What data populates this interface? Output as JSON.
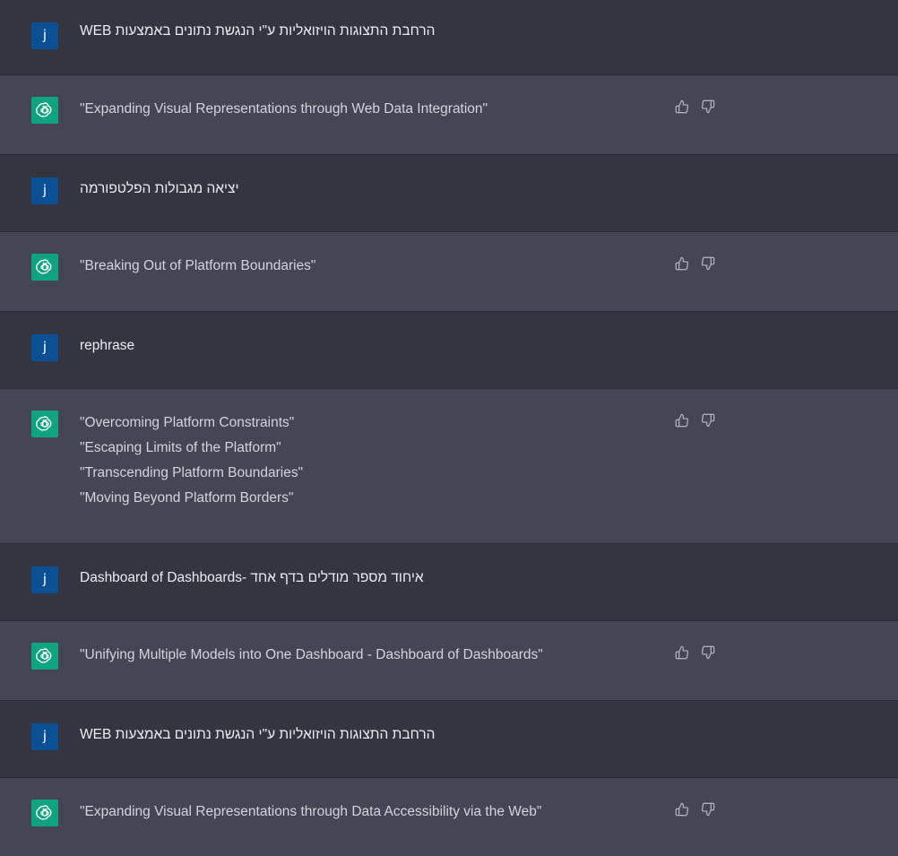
{
  "colors": {
    "user_bg": "#343541",
    "bot_bg": "#444654",
    "user_avatar": "#0b4f94",
    "bot_avatar": "#10a37f",
    "text": "#ececf1"
  },
  "user_avatar_letter": "j",
  "messages": [
    {
      "role": "user",
      "text": "הרחבת התצוגות הויזואליות ע\"י הנגשת נתונים באמצעות WEB"
    },
    {
      "role": "assistant",
      "lines": [
        "\"Expanding Visual Representations through Web Data Integration\""
      ]
    },
    {
      "role": "user",
      "text": "יציאה מגבולות הפלטפורמה"
    },
    {
      "role": "assistant",
      "lines": [
        "\"Breaking Out of Platform Boundaries\""
      ]
    },
    {
      "role": "user",
      "text": "rephrase"
    },
    {
      "role": "assistant",
      "lines": [
        "\"Overcoming Platform Constraints\"",
        "\"Escaping Limits of the Platform\"",
        "\"Transcending Platform Boundaries\"",
        "\"Moving Beyond Platform Borders\""
      ]
    },
    {
      "role": "user",
      "text": "איחוד מספר מודלים בדף אחד -Dashboard of Dashboards"
    },
    {
      "role": "assistant",
      "lines": [
        "\"Unifying Multiple Models into One Dashboard - Dashboard of Dashboards\""
      ]
    },
    {
      "role": "user",
      "text": "הרחבת התצוגות הויזואליות ע\"י הנגשת נתונים באמצעות WEB"
    },
    {
      "role": "assistant",
      "lines": [
        "\"Expanding Visual Representations through Data Accessibility via the Web\""
      ]
    }
  ],
  "icons": {
    "user_avatar": "user-avatar",
    "bot_avatar": "openai-logo-icon",
    "like": "thumbs-up-icon",
    "dislike": "thumbs-down-icon"
  }
}
